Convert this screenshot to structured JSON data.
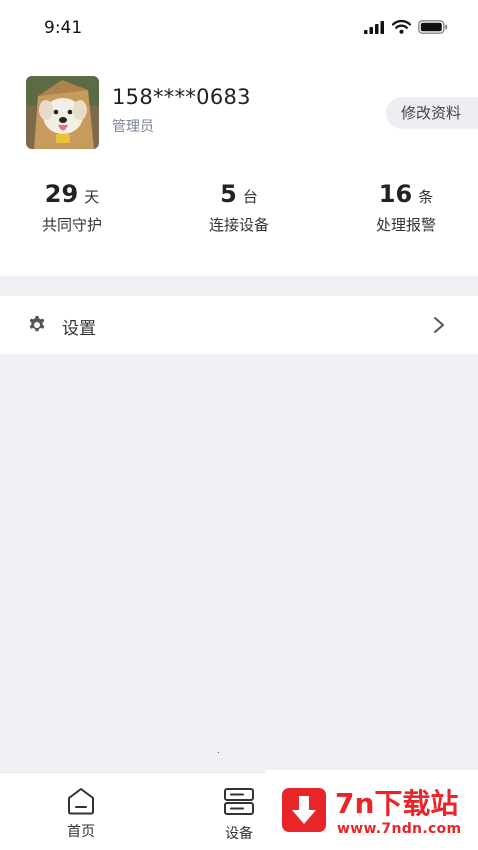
{
  "status_bar": {
    "time": "9:41"
  },
  "profile": {
    "phone": "158****0683",
    "role": "管理员",
    "edit_label": "修改资料"
  },
  "stats": [
    {
      "value": "29",
      "unit": "天",
      "label": "共同守护"
    },
    {
      "value": "5",
      "unit": "台",
      "label": "连接设备"
    },
    {
      "value": "16",
      "unit": "条",
      "label": "处理报警"
    }
  ],
  "settings": {
    "label": "设置"
  },
  "tab_bar": {
    "items": [
      {
        "label": "首页",
        "icon": "home-icon"
      },
      {
        "label": "设备",
        "icon": "device-icon"
      }
    ]
  },
  "watermark": {
    "title": "7n下载站",
    "url": "www.7ndn.com",
    "accent": "#e8262a"
  }
}
